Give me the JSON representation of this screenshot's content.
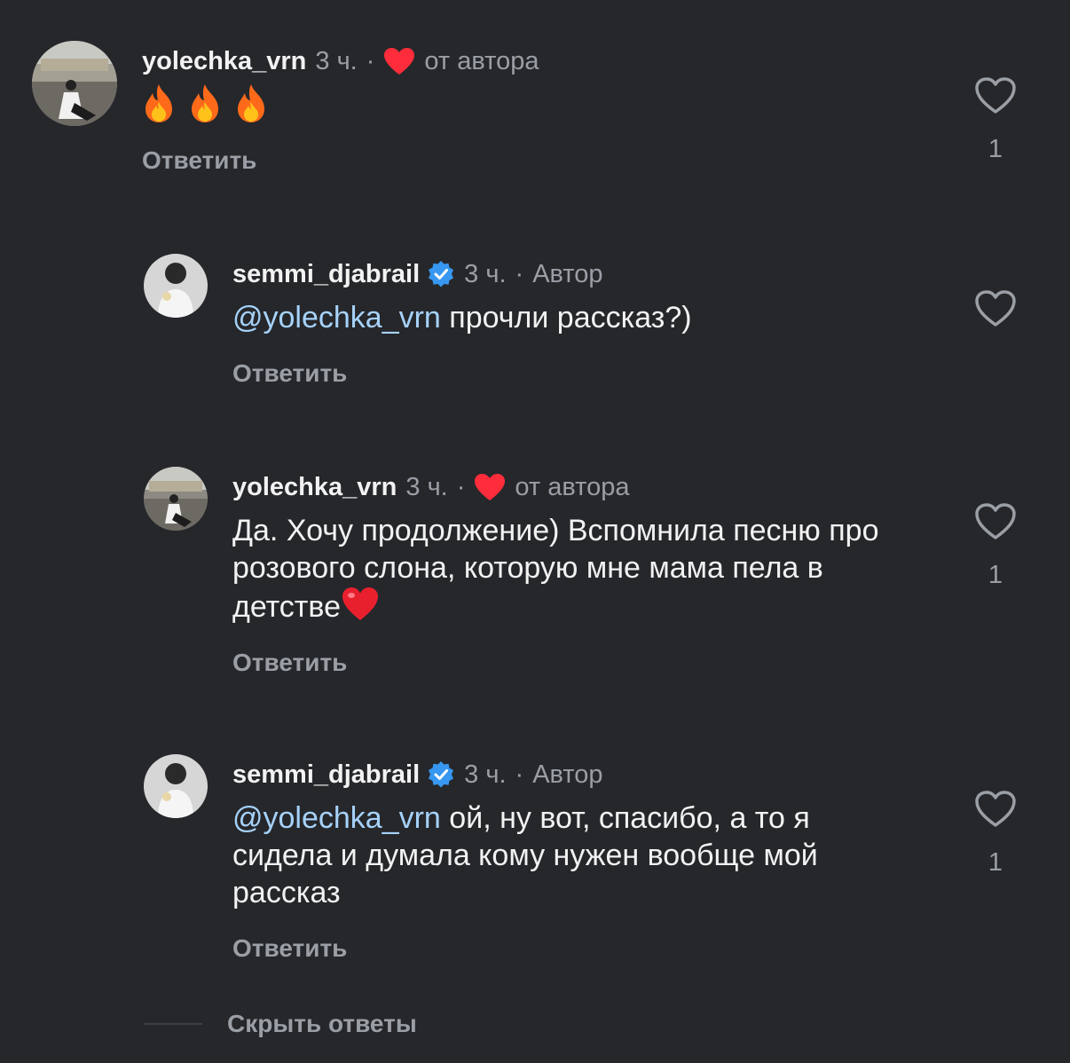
{
  "comments": [
    {
      "username": "yolechka_vrn",
      "time": "3 ч.",
      "dot": "·",
      "tag": "от автора",
      "text": "",
      "emoji": "fire x3",
      "reply_label": "Ответить",
      "likes": "1"
    },
    {
      "username": "semmi_djabrail",
      "time": "3 ч.",
      "dot": "·",
      "tag": "Автор",
      "mention": "@yolechka_vrn",
      "text": " прочли рассказ?)",
      "reply_label": "Ответить",
      "likes": ""
    },
    {
      "username": "yolechka_vrn",
      "time": "3 ч.",
      "dot": "·",
      "tag": "от автора",
      "text": "Да. Хочу продолжение) Вспомнила песню про розового слона, которую мне мама пела в детстве",
      "reply_label": "Ответить",
      "likes": "1"
    },
    {
      "username": "semmi_djabrail",
      "time": "3 ч.",
      "dot": "·",
      "tag": "Автор",
      "mention": "@yolechka_vrn",
      "text": " ой, ну вот, спасибо, а то я сидела и думала кому нужен вообще мой рассказ",
      "reply_label": "Ответить",
      "likes": "1"
    }
  ],
  "hide_replies_label": "Скрыть ответы",
  "colors": {
    "background": "#25272b",
    "primary_text": "#f2f2f2",
    "secondary_text": "#9a9ea5",
    "mention": "#a6d2fa",
    "heart_red": "#ff2d3b",
    "verified_blue": "#3897f0"
  },
  "icons": {
    "like": "heart-outline-icon",
    "author_like": "red-heart-icon",
    "verified": "verified-badge-icon",
    "fire": "fire-emoji-icon"
  }
}
